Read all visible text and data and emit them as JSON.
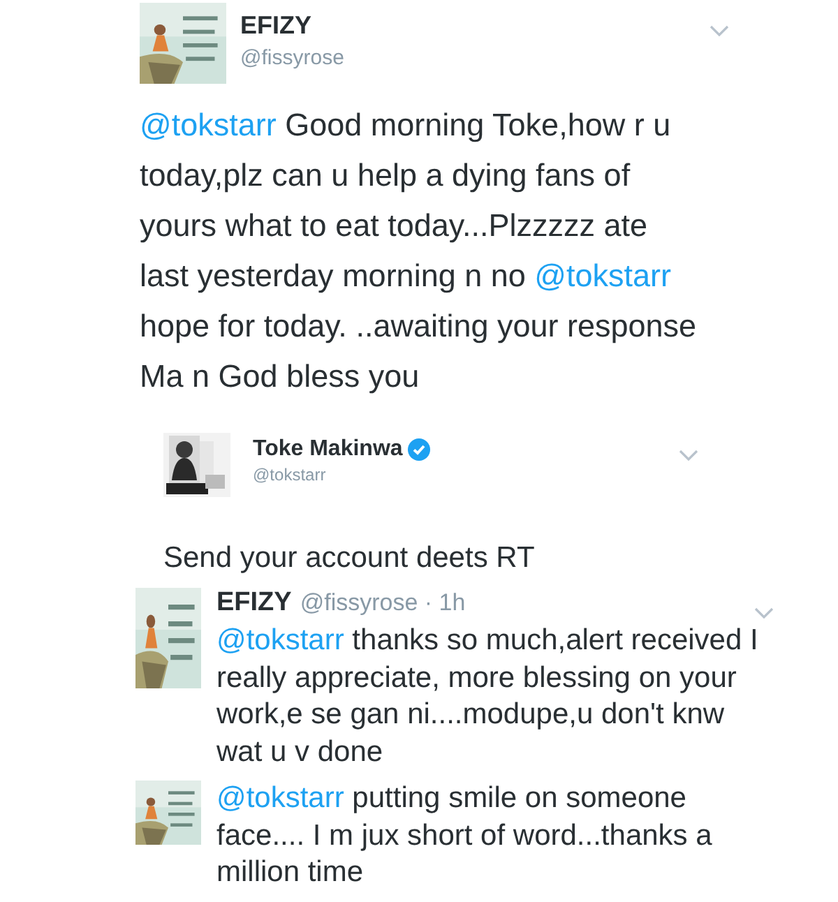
{
  "tweets": [
    {
      "kind": "full",
      "name": "EFIZY",
      "handle": "@fissyrose",
      "verified": false,
      "menu": true,
      "body": [
        {
          "kind": "mention",
          "text": "@tokstarr"
        },
        {
          "kind": "text",
          "text": " Good morning Toke,how r u today,plz can u help a dying fans of yours what to eat today...Plzzzzz ate last yesterday morning n no "
        },
        {
          "kind": "mention",
          "text": "@tokstarr"
        },
        {
          "kind": "text",
          "text": " hope for today. ..awaiting your response Ma n God bless you"
        }
      ]
    },
    {
      "kind": "reply",
      "name": "Toke Makinwa",
      "handle": "@tokstarr",
      "verified": true,
      "menu": true,
      "body": [
        {
          "kind": "text",
          "text": "Send your account deets RT"
        }
      ]
    },
    {
      "kind": "inline",
      "name": "EFIZY",
      "handle": "@fissyrose · 1h",
      "verified": false,
      "menu": true,
      "body": [
        {
          "kind": "mention",
          "text": "@tokstarr"
        },
        {
          "kind": "text",
          "text": " thanks so much,alert received I really appreciate, more blessing on your work,e se gan ni....modupe,u don't knw wat u v done"
        }
      ]
    },
    {
      "kind": "continuation",
      "verified": false,
      "menu": false,
      "body": [
        {
          "kind": "mention",
          "text": "@tokstarr"
        },
        {
          "kind": "text",
          "text": " putting smile on someone face.... I m jux short of word...thanks a million time"
        }
      ]
    }
  ]
}
